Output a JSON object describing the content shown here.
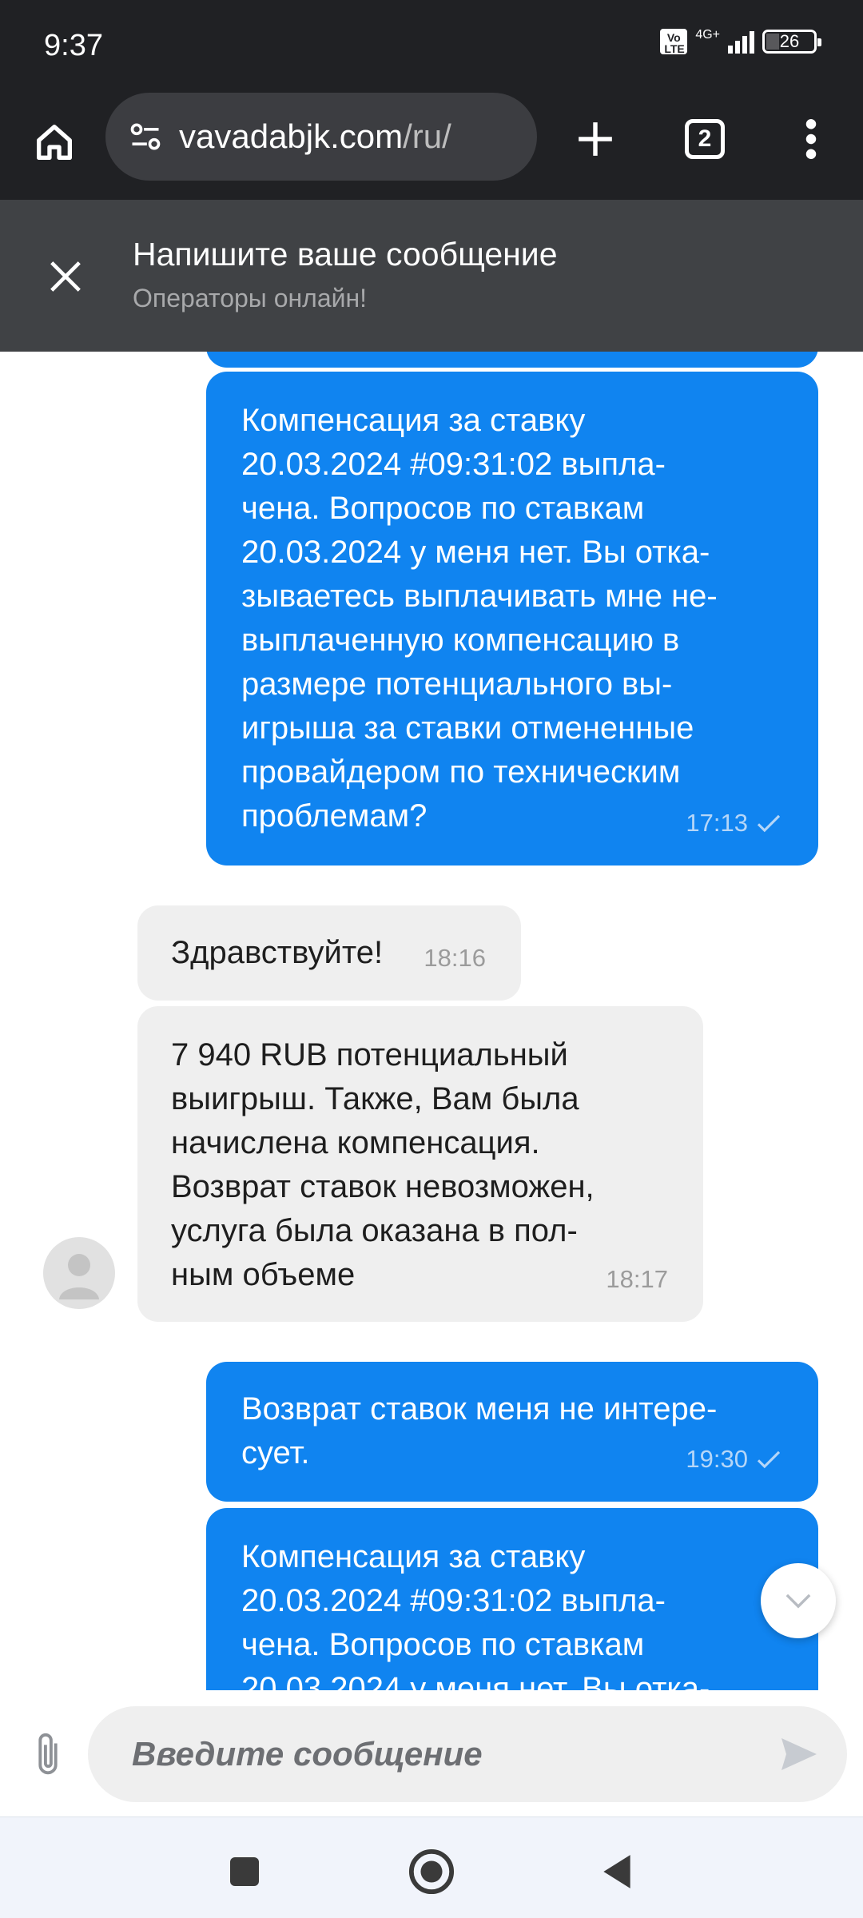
{
  "status_bar": {
    "time": "9:37",
    "volte": "Vo LTE",
    "network": "4G+",
    "battery": "26",
    "battery_fraction": 0.26
  },
  "browser": {
    "url_domain": "vavadabjk.com",
    "url_path": "/ru/",
    "tab_count": "2",
    "icons": [
      "home-icon",
      "site-settings-icon",
      "plus-icon",
      "tabs-icon",
      "more-vertical-icon"
    ]
  },
  "chat_header": {
    "title": "Напишите ваше сообщение",
    "subtitle": "Операторы онлайн!"
  },
  "messages": [
    {
      "direction": "out",
      "text": "Компенсация за ставку\n20.03.2024 #09:31:02 выпла-\nчена. Вопросов по ставкам\n20.03.2024 у меня нет. Вы отка-\nзываетесь выплачивать мне не-\nвыплаченную компенсацию в\nразмере потенциального вы-\nигрыша за ставки отмененные\nпровайдером по техническим\nпроблемам?",
      "time": "17:13",
      "status": "read-check"
    },
    {
      "direction": "in",
      "text": "Здравствуйте!",
      "time": "18:16"
    },
    {
      "direction": "in",
      "text": "7 940 RUB потенциальный\nвыигрыш. Также, Вам была\nначислена компенсация.\nВозврат ставок невозможен,\nуслуга была оказана в пол-\nным объеме",
      "time": "18:17"
    },
    {
      "direction": "out",
      "text": "Возврат ставок меня не интере-\nсует.",
      "time": "19:30",
      "status": "read-check"
    },
    {
      "direction": "out",
      "text": "Компенсация за ставку\n20.03.2024 #09:31:02 выпла-\nчена. Вопросов по ставкам\n20.03.2024 у меня нет. Вы отка-",
      "time": "",
      "status": ""
    }
  ],
  "input": {
    "placeholder": "Введите сообщение",
    "value": ""
  },
  "colors": {
    "outgoing_bubble": "#1084f0",
    "incoming_bubble": "#efefef",
    "browser_bar": "#202124",
    "chat_header": "#404245"
  }
}
